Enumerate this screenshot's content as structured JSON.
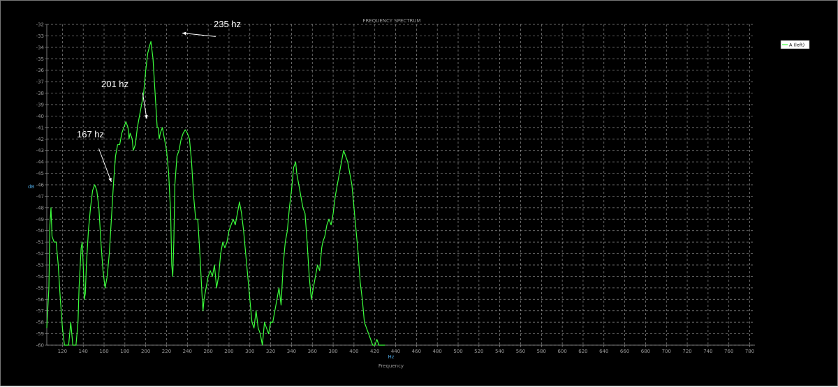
{
  "chart_data": {
    "type": "line",
    "title": "FREQUENCY SPECTRUM",
    "xlabel": "Frequency",
    "xunit": "Hz",
    "ylabel": "dB",
    "xlim": [
      105,
      785
    ],
    "ylim": [
      -60,
      -32
    ],
    "grid": true,
    "legend_position": "top-right",
    "x_ticks": [
      120,
      140,
      160,
      180,
      200,
      220,
      240,
      260,
      280,
      300,
      320,
      340,
      360,
      380,
      400,
      420,
      440,
      460,
      480,
      500,
      520,
      540,
      560,
      580,
      600,
      620,
      640,
      660,
      680,
      700,
      720,
      740,
      760,
      780
    ],
    "y_ticks": [
      -32,
      -33,
      -34,
      -35,
      -36,
      -37,
      -38,
      -39,
      -40,
      -41,
      -42,
      -43,
      -44,
      -45,
      -46,
      -47,
      -48,
      -49,
      -50,
      -51,
      -52,
      -53,
      -54,
      -55,
      -56,
      -57,
      -58,
      -59,
      -60
    ],
    "series": [
      {
        "name": "A (left)",
        "color": "#3cff3c",
        "points": [
          [
            105,
            -58.5
          ],
          [
            107,
            -55
          ],
          [
            108,
            -49.5
          ],
          [
            109,
            -48
          ],
          [
            110,
            -50.5
          ],
          [
            112,
            -51
          ],
          [
            114,
            -51
          ],
          [
            116,
            -53
          ],
          [
            118,
            -56
          ],
          [
            120,
            -58.5
          ],
          [
            122,
            -61
          ],
          [
            126,
            -61
          ],
          [
            128,
            -58
          ],
          [
            130,
            -61
          ],
          [
            133,
            -61
          ],
          [
            135,
            -58
          ],
          [
            136,
            -55
          ],
          [
            138,
            -51.5
          ],
          [
            139,
            -51
          ],
          [
            140,
            -53
          ],
          [
            141,
            -56
          ],
          [
            142,
            -55.5
          ],
          [
            143,
            -53
          ],
          [
            145,
            -50
          ],
          [
            147,
            -48
          ],
          [
            149,
            -46.5
          ],
          [
            151,
            -46
          ],
          [
            153,
            -46.5
          ],
          [
            155,
            -48
          ],
          [
            157,
            -51
          ],
          [
            159,
            -53.5
          ],
          [
            161,
            -55
          ],
          [
            163,
            -54
          ],
          [
            165,
            -52
          ],
          [
            167,
            -49
          ],
          [
            169,
            -46
          ],
          [
            171,
            -43.5
          ],
          [
            173,
            -42.5
          ],
          [
            175,
            -42.5
          ],
          [
            177,
            -41.5
          ],
          [
            179,
            -41
          ],
          [
            181,
            -40.5
          ],
          [
            183,
            -41
          ],
          [
            184,
            -42
          ],
          [
            185,
            -41.5
          ],
          [
            187,
            -42
          ],
          [
            188,
            -43
          ],
          [
            190,
            -42.5
          ],
          [
            192,
            -41
          ],
          [
            194,
            -40
          ],
          [
            196,
            -39
          ],
          [
            198,
            -38
          ],
          [
            200,
            -36
          ],
          [
            202,
            -34.5
          ],
          [
            204,
            -33.8
          ],
          [
            205,
            -33.5
          ],
          [
            207,
            -35
          ],
          [
            209,
            -38
          ],
          [
            211,
            -41
          ],
          [
            212,
            -41
          ],
          [
            213,
            -42
          ],
          [
            214,
            -41.5
          ],
          [
            216,
            -41
          ],
          [
            218,
            -42
          ],
          [
            220,
            -43
          ],
          [
            222,
            -45
          ],
          [
            224,
            -48.5
          ],
          [
            225,
            -53
          ],
          [
            226,
            -54
          ],
          [
            227,
            -51
          ],
          [
            228,
            -46
          ],
          [
            230,
            -43.5
          ],
          [
            232,
            -43
          ],
          [
            234,
            -42
          ],
          [
            236,
            -41.5
          ],
          [
            238,
            -41.2
          ],
          [
            240,
            -41.5
          ],
          [
            242,
            -42
          ],
          [
            244,
            -44
          ],
          [
            246,
            -47
          ],
          [
            248,
            -49
          ],
          [
            250,
            -49
          ],
          [
            252,
            -52
          ],
          [
            254,
            -55.5
          ],
          [
            255,
            -57
          ],
          [
            256,
            -56
          ],
          [
            258,
            -55
          ],
          [
            260,
            -54
          ],
          [
            262,
            -53.5
          ],
          [
            264,
            -54
          ],
          [
            266,
            -53
          ],
          [
            267,
            -54
          ],
          [
            268,
            -55
          ],
          [
            270,
            -54
          ],
          [
            272,
            -52
          ],
          [
            274,
            -51
          ],
          [
            276,
            -51.5
          ],
          [
            278,
            -51
          ],
          [
            280,
            -50
          ],
          [
            282,
            -49.5
          ],
          [
            284,
            -49
          ],
          [
            286,
            -49.5
          ],
          [
            288,
            -48.5
          ],
          [
            290,
            -47.5
          ],
          [
            292,
            -48.5
          ],
          [
            294,
            -50
          ],
          [
            296,
            -52
          ],
          [
            298,
            -54
          ],
          [
            300,
            -56
          ],
          [
            302,
            -58
          ],
          [
            304,
            -58.5
          ],
          [
            306,
            -57
          ],
          [
            308,
            -58.5
          ],
          [
            310,
            -59
          ],
          [
            312,
            -60.5
          ],
          [
            314,
            -58
          ],
          [
            316,
            -58.5
          ],
          [
            318,
            -59
          ],
          [
            320,
            -58
          ],
          [
            322,
            -58
          ],
          [
            324,
            -57
          ],
          [
            326,
            -56
          ],
          [
            328,
            -55
          ],
          [
            330,
            -56.5
          ],
          [
            332,
            -53
          ],
          [
            334,
            -51
          ],
          [
            336,
            -50
          ],
          [
            338,
            -48
          ],
          [
            340,
            -46.5
          ],
          [
            342,
            -44.5
          ],
          [
            344,
            -44
          ],
          [
            345,
            -45
          ],
          [
            347,
            -46
          ],
          [
            349,
            -47
          ],
          [
            351,
            -48
          ],
          [
            353,
            -48.5
          ],
          [
            355,
            -51
          ],
          [
            357,
            -54
          ],
          [
            359,
            -56
          ],
          [
            361,
            -55
          ],
          [
            363,
            -54
          ],
          [
            365,
            -53
          ],
          [
            367,
            -53.5
          ],
          [
            369,
            -51.5
          ],
          [
            370,
            -51
          ],
          [
            372,
            -50.5
          ],
          [
            374,
            -49.5
          ],
          [
            376,
            -49
          ],
          [
            378,
            -49.5
          ],
          [
            380,
            -48.5
          ],
          [
            382,
            -47
          ],
          [
            384,
            -46
          ],
          [
            386,
            -45
          ],
          [
            388,
            -44
          ],
          [
            390,
            -43
          ],
          [
            392,
            -43.5
          ],
          [
            394,
            -44
          ],
          [
            396,
            -45
          ],
          [
            398,
            -46
          ],
          [
            400,
            -48
          ],
          [
            402,
            -50
          ],
          [
            404,
            -52
          ],
          [
            406,
            -54.5
          ],
          [
            408,
            -56
          ],
          [
            410,
            -58
          ],
          [
            412,
            -58.5
          ],
          [
            414,
            -59
          ],
          [
            416,
            -59.5
          ],
          [
            418,
            -60
          ],
          [
            419,
            -61
          ],
          [
            420,
            -60
          ],
          [
            422,
            -59.5
          ],
          [
            424,
            -60
          ],
          [
            426,
            -60.5
          ],
          [
            428,
            -61
          ],
          [
            430,
            -61
          ]
        ]
      }
    ],
    "annotations": [
      {
        "text": "167 hz",
        "x": 167,
        "y": -46
      },
      {
        "text": "201 hz",
        "x": 201,
        "y": -40.5
      },
      {
        "text": "235 hz",
        "x": 235,
        "y": -33
      }
    ]
  }
}
